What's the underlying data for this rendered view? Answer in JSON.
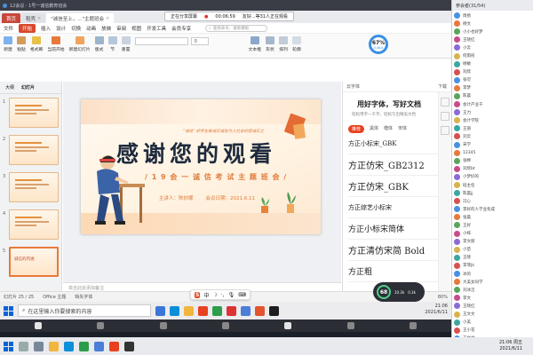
{
  "meeting": {
    "title": "12会议 · 1号一诚信教育班会",
    "share_label": "正在分享屏幕",
    "duration": "00:06:59",
    "share_user": "友好...等31人正在观看"
  },
  "wps": {
    "tabs": [
      {
        "label": "首页"
      },
      {
        "label": "稻壳"
      },
      {
        "label": "\"诚信至上，...\"主题班会"
      }
    ],
    "menus": [
      "文件",
      "开始",
      "插入",
      "设计",
      "切换",
      "动画",
      "放映",
      "审阅",
      "视图",
      "开发工具",
      "会员专享"
    ],
    "active_menu": "开始",
    "search_placeholder": "查找命令、搜索模板",
    "gauge_value": "67%",
    "gauge_sub": "0.4K/s",
    "tools": [
      {
        "label": "新建"
      },
      {
        "label": "粘贴"
      },
      {
        "label": "格式刷"
      },
      {
        "label": "当前开始"
      },
      {
        "label": "新建幻灯片"
      },
      {
        "label": "版式"
      },
      {
        "label": "节"
      },
      {
        "label": "重置"
      }
    ],
    "font_name": "",
    "font_size": "0",
    "right_tools": [
      {
        "label": "文本框"
      },
      {
        "label": "形状"
      },
      {
        "label": "排列"
      },
      {
        "label": "轮廓"
      }
    ],
    "pane_tabs": [
      "大纲",
      "幻灯片"
    ],
    "slide_numbers": [
      "1",
      "2",
      "3",
      "4",
      "5"
    ],
    "slide5_label": "诚信的内涵",
    "notes": "单击此处添加备注",
    "status": {
      "slide_count": "幻灯片 25 / 25",
      "theme": "Office 主题",
      "fix": "缺失字体",
      "zoom": "80%"
    }
  },
  "slide": {
    "banner": "\"诚信\" 好学生做诚实诚信为人社会的是诚实之",
    "title": "感谢您的观看",
    "subtitle": "/ 1 9 会 一 诚 信 考 试 主 题 班 会 /",
    "presenter": "主讲人：陈妙娜",
    "date": "会议日期：2021.6.11"
  },
  "font_panel": {
    "header_left": "云字体",
    "header_right": "下载",
    "title": "用好字体，写好文档",
    "desc": "轻松用字一千字，轻松写出精美文档",
    "tabs": [
      "推荐",
      "黑体",
      "楷体",
      "宋体"
    ],
    "active_tab": "推荐",
    "fonts": [
      {
        "name": "方正小标宋_GBK",
        "size": 7
      },
      {
        "name": "方正仿宋_GB2312",
        "size": 10
      },
      {
        "name": "方正仿宋_GBK",
        "size": 10
      },
      {
        "name": "方正综艺小标宋",
        "size": 7
      },
      {
        "name": "方正小标宋简体",
        "size": 9
      },
      {
        "name": "方正清仿宋简 Bold",
        "size": 10
      },
      {
        "name": "方正粗",
        "size": 9
      }
    ]
  },
  "perf": {
    "cpu": "68",
    "up": "10.2k",
    "down": "0.3k"
  },
  "ime": {
    "lang": "中"
  },
  "taskbar": {
    "search_placeholder": "在这里输入你要搜索的内容",
    "time": "21:06",
    "date": "2021/6/11"
  },
  "sysbar": {
    "time": "21:06 周五",
    "date": "2021/6/11"
  },
  "attendees": {
    "header": "参会者(31/54)",
    "list": [
      "周扬",
      "杨文",
      "小小也好梦",
      "王晓红",
      "小云",
      "何雨彤",
      "杨敏",
      "刘欣",
      "张可",
      "李梦",
      "陈晨",
      "会计产业干",
      "王力",
      "会计学院",
      "王丽",
      "刘云",
      "宋学",
      "12345",
      "张婷",
      "刘欣bt",
      "小梦好的",
      "班主任",
      "陈晨jj",
      "冯心",
      "李好的人学业有成",
      "张晨",
      "王好",
      "小梓",
      "李文丽",
      "小苗",
      "王晓",
      "李菲Jk",
      "冰的",
      "大美女同学",
      "刘冰洁",
      "李文",
      "王晓红",
      "王文文",
      "小美",
      "王小花",
      "王文文"
    ]
  }
}
